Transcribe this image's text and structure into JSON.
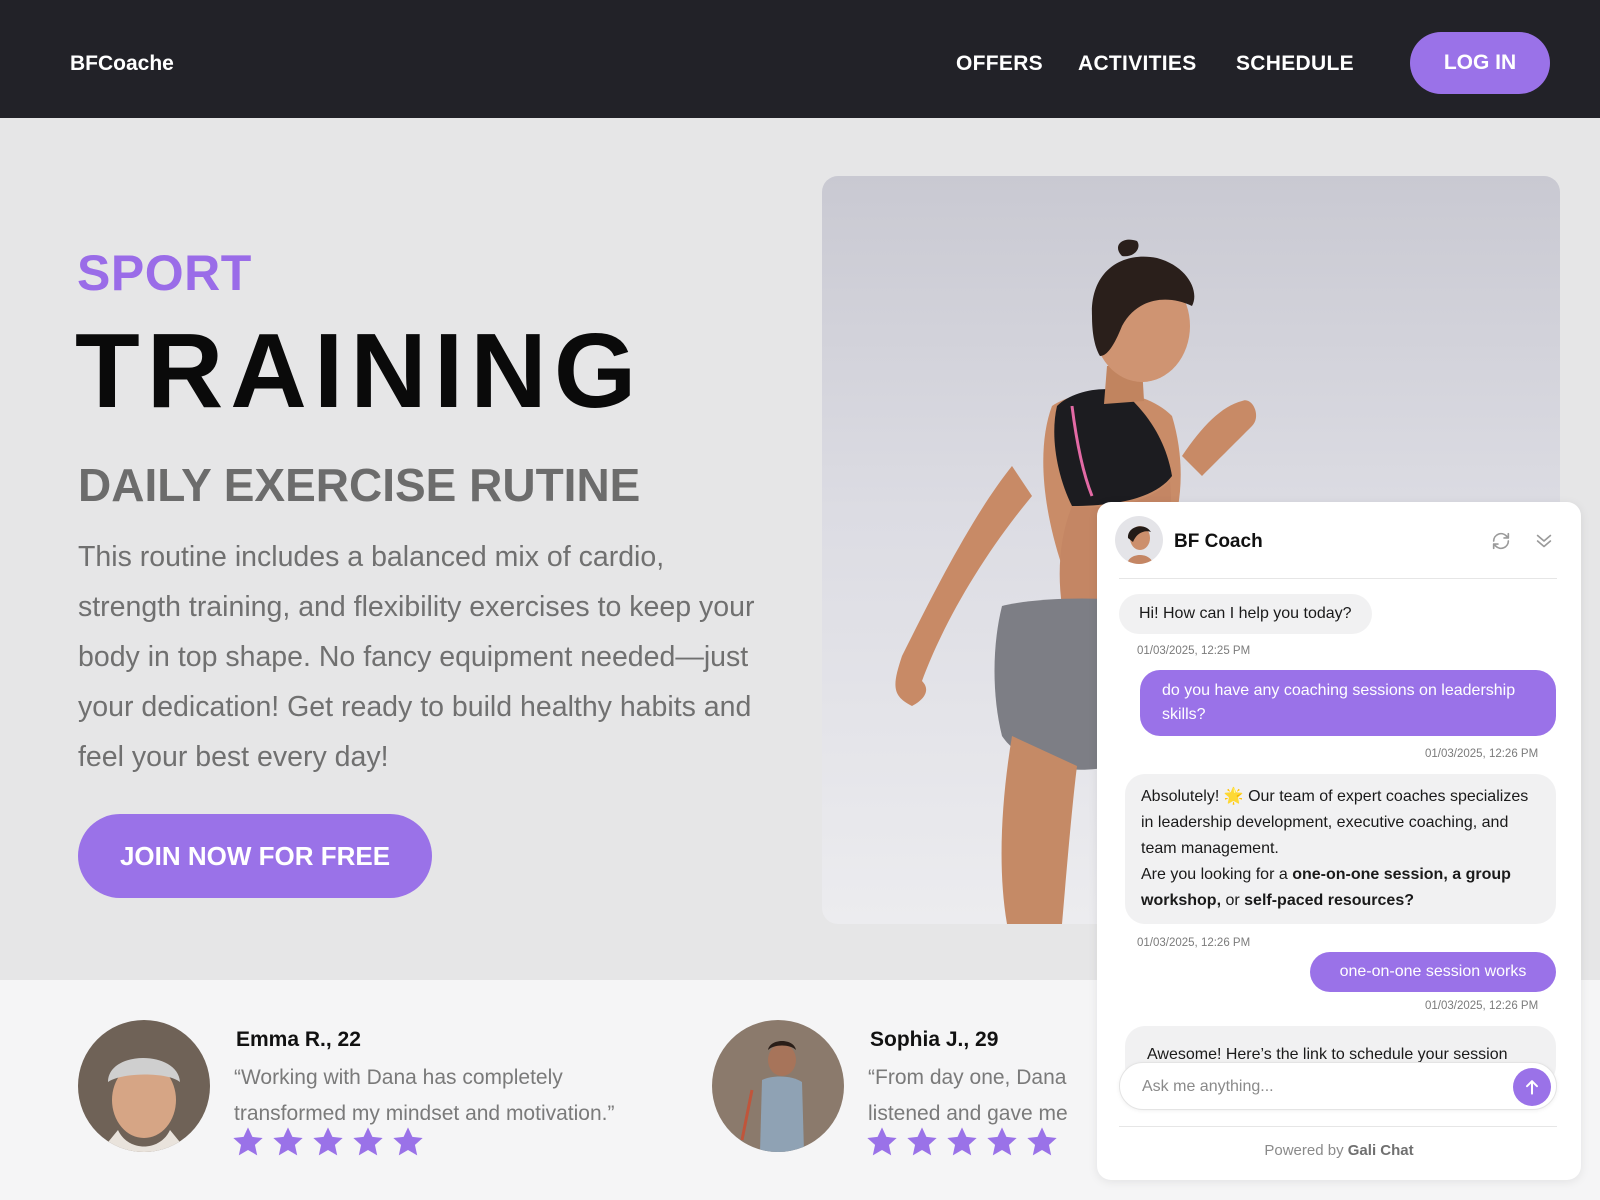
{
  "nav": {
    "brand": "BFCoache",
    "links": [
      "OFFERS",
      "ACTIVITIES",
      "SCHEDULE"
    ],
    "login_label": "LOG IN"
  },
  "hero": {
    "eyebrow": "SPORT",
    "headline": "TRAINING",
    "subhead": "DAILY EXERCISE RUTINE",
    "body": "This routine includes a balanced mix of cardio, strength training, and flexibility exercises to keep your body in top shape. No fancy equipment needed—just your dedication! Get ready to build healthy habits and feel your best every day!",
    "cta_label": "JOIN NOW FOR FREE",
    "image_icon": "runner-photo"
  },
  "testimonials": [
    {
      "name": "Emma R., 22",
      "quote": "“Working with Dana has completely transformed my mindset and motivation.”",
      "rating": 5
    },
    {
      "name": "Sophia J., 29",
      "quote": "“From day one, Dana listened and gave me actionable advice that helped me",
      "rating": 5
    }
  ],
  "chat": {
    "title": "BF Coach",
    "messages": {
      "m1": {
        "text": "Hi! How can I help you today?",
        "time": "01/03/2025, 12:25 PM"
      },
      "m2": {
        "text": "do you have any coaching sessions on leadership skills?",
        "time": "01/03/2025, 12:26 PM"
      },
      "m3": {
        "line1": "Absolutely! 🌟 Our team of expert coaches specializes in leadership development, executive coaching, and team management.",
        "line2_prefix": "Are you looking for a ",
        "opt1": "one-on-one session, a group workshop,",
        "sep": " or ",
        "opt2": "self-paced resources?",
        "time": "01/03/2025, 12:26 PM"
      },
      "m4": {
        "text": "one-on-one session works",
        "time": "01/03/2025, 12:26 PM"
      },
      "m5": {
        "text": "Awesome! Here’s the link to schedule your session"
      }
    },
    "input_placeholder": "Ask me anything...",
    "powered_prefix": "Powered by ",
    "powered_brand": "Gali Chat"
  },
  "colors": {
    "accent": "#9a72e8",
    "nav_bg": "#222228",
    "page_bg": "#e6e6e7"
  }
}
